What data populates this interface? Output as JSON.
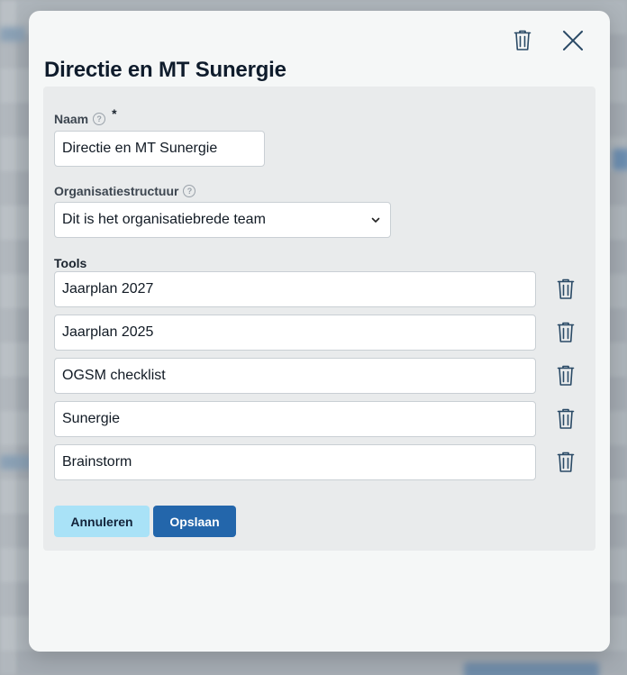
{
  "modal": {
    "title": "Directie en MT Sunergie",
    "delete_icon": "trash-icon",
    "close_icon": "close-icon"
  },
  "form": {
    "name": {
      "label": "Naam",
      "required_mark": "*",
      "help_glyph": "?",
      "value": "Directie en MT Sunergie"
    },
    "org_structure": {
      "label": "Organisatiestructuur",
      "help_glyph": "?",
      "selected": "Dit is het organisatiebrede team"
    },
    "tools": {
      "label": "Tools",
      "items": [
        {
          "value": "Jaarplan 2027"
        },
        {
          "value": "Jaarplan 2025"
        },
        {
          "value": "OGSM checklist"
        },
        {
          "value": "Sunergie"
        },
        {
          "value": "Brainstorm"
        }
      ]
    },
    "buttons": {
      "cancel": "Annuleren",
      "save": "Opslaan"
    }
  },
  "colors": {
    "primary": "#2366ab",
    "secondary": "#a9e2f7",
    "icon": "#2a4a66"
  }
}
